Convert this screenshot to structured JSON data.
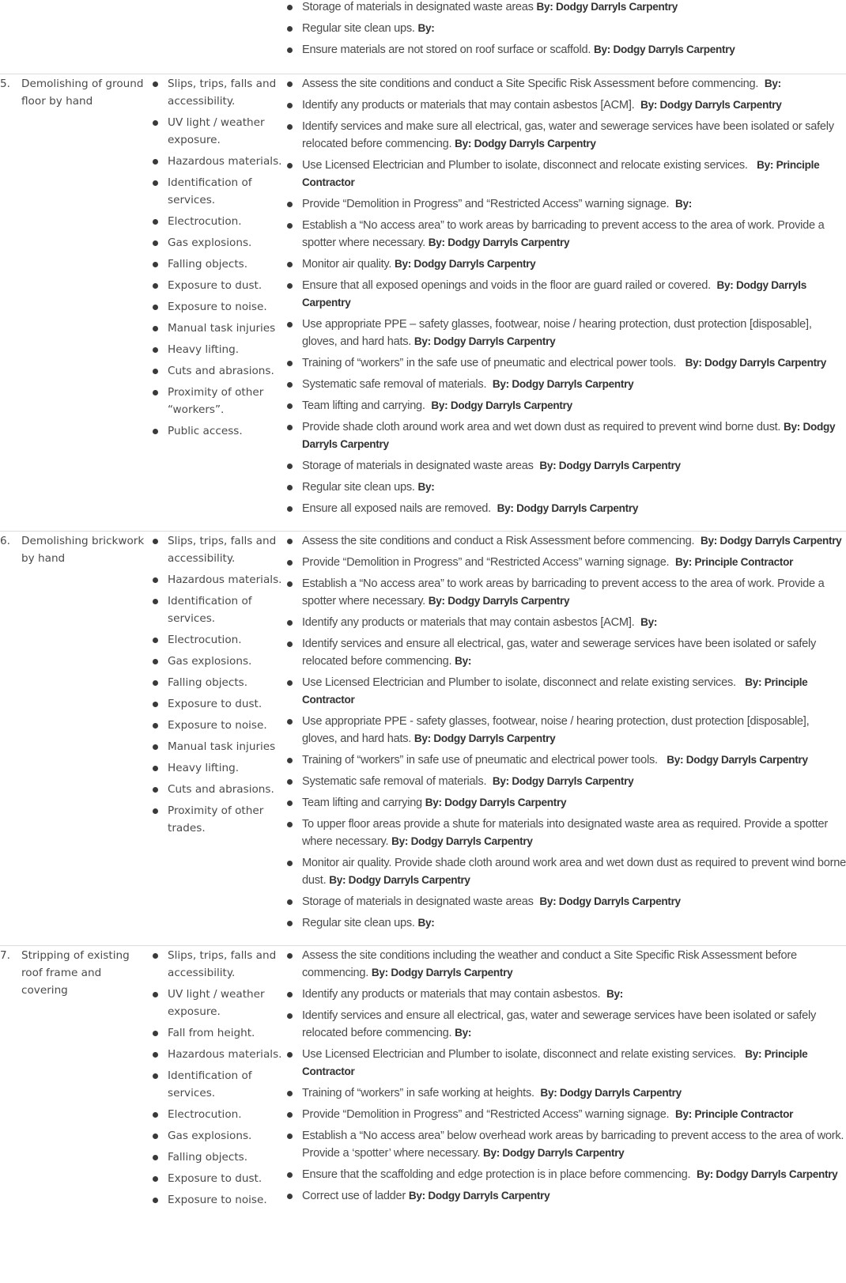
{
  "rows": [
    {
      "number": "",
      "task": "",
      "hazards": [],
      "controls": [
        {
          "text": "Storage of materials in designated waste areas ",
          "by": "By: Dodgy Darryls Carpentry"
        },
        {
          "text": "Regular site clean ups. ",
          "by": "By:"
        },
        {
          "text": "Ensure materials are not stored on roof surface or scaffold. ",
          "by": "By: Dodgy Darryls Carpentry"
        }
      ]
    },
    {
      "number": "5.",
      "task": "Demolishing of ground floor by hand",
      "hazards": [
        "Slips, trips, falls and accessibility.",
        "UV light / weather exposure.",
        "Hazardous materials.",
        "Identification of services.",
        "Electrocution.",
        "Gas explosions.",
        "Falling objects.",
        "Exposure to dust.",
        "Exposure to noise.",
        "Manual task injuries",
        "Heavy lifting.",
        "Cuts and abrasions.",
        "Proximity of other “workers”.",
        "Public access."
      ],
      "controls": [
        {
          "text": "Assess the site conditions and conduct a Site Specific Risk Assessment before commencing.  ",
          "by": "By:"
        },
        {
          "text": "Identify any products or materials that may contain asbestos [ACM].  ",
          "by": "By: Dodgy Darryls Carpentry"
        },
        {
          "text": "Identify services and make sure all electrical, gas, water and sewerage services have been isolated or safely relocated before commencing. ",
          "by": "By: Dodgy Darryls Carpentry"
        },
        {
          "text": "Use Licensed Electrician and Plumber to isolate, disconnect and relocate existing services.   ",
          "by": "By: Principle Contractor"
        },
        {
          "text": "Provide “Demolition in Progress” and “Restricted Access” warning signage.  ",
          "by": "By:"
        },
        {
          "text": "Establish a “No access area” to work areas by barricading to prevent access to the area of work. Provide a spotter where necessary. ",
          "by": "By: Dodgy Darryls Carpentry"
        },
        {
          "text": "Monitor air quality. ",
          "by": "By: Dodgy Darryls Carpentry"
        },
        {
          "text": "Ensure that all exposed openings and voids in the floor are guard railed or covered.  ",
          "by": "By: Dodgy Darryls Carpentry"
        },
        {
          "text": "Use appropriate PPE – safety glasses, footwear, noise / hearing protection, dust protection [disposable], gloves, and hard hats. ",
          "by": "By: Dodgy Darryls Carpentry"
        },
        {
          "text": "Training of “workers” in the safe use of pneumatic and electrical power tools.   ",
          "by": "By: Dodgy Darryls Carpentry"
        },
        {
          "text": "Systematic safe removal of materials.  ",
          "by": "By: Dodgy Darryls Carpentry"
        },
        {
          "text": "Team lifting and carrying.  ",
          "by": "By: Dodgy Darryls Carpentry"
        },
        {
          "text": "Provide shade cloth around work area and wet down dust as required to prevent wind borne dust. ",
          "by": "By: Dodgy Darryls Carpentry"
        },
        {
          "text": "Storage of materials in designated waste areas  ",
          "by": "By: Dodgy Darryls Carpentry"
        },
        {
          "text": "Regular site clean ups. ",
          "by": "By:"
        },
        {
          "text": "Ensure all exposed nails are removed.  ",
          "by": "By: Dodgy Darryls Carpentry"
        }
      ]
    },
    {
      "number": "6.",
      "task": "Demolishing brickwork by hand",
      "hazards": [
        "Slips, trips, falls and accessibility.",
        "Hazardous materials.",
        "Identification of services.",
        "Electrocution.",
        "Gas explosions.",
        "Falling objects.",
        "Exposure to dust.",
        "Exposure to noise.",
        "Manual task injuries",
        "Heavy lifting.",
        "Cuts and abrasions.",
        "Proximity of other trades."
      ],
      "controls": [
        {
          "text": "Assess the site conditions and conduct a Risk Assessment before commencing.  ",
          "by": "By: Dodgy Darryls Carpentry"
        },
        {
          "text": "Provide “Demolition in Progress” and “Restricted Access” warning signage.  ",
          "by": "By: Principle Contractor"
        },
        {
          "text": "Establish a “No access area” to work areas by barricading to prevent access to the area of work. Provide a spotter where necessary. ",
          "by": "By: Dodgy Darryls Carpentry"
        },
        {
          "text": "Identify any products or materials that may contain asbestos [ACM].  ",
          "by": "By:"
        },
        {
          "text": "Identify services and ensure all electrical, gas, water and sewerage services have been isolated or safely relocated before commencing. ",
          "by": "By:"
        },
        {
          "text": "Use Licensed Electrician and Plumber to isolate, disconnect and relate existing services.   ",
          "by": "By: Principle Contractor"
        },
        {
          "text": "Use appropriate PPE - safety glasses, footwear, noise / hearing protection, dust protection [disposable], gloves, and hard hats. ",
          "by": "By: Dodgy Darryls Carpentry"
        },
        {
          "text": "Training of “workers” in safe use of pneumatic and electrical power tools.   ",
          "by": "By: Dodgy Darryls Carpentry"
        },
        {
          "text": "Systematic safe removal of materials.  ",
          "by": "By: Dodgy Darryls Carpentry"
        },
        {
          "text": "Team lifting and carrying ",
          "by": "By: Dodgy Darryls Carpentry"
        },
        {
          "text": "To upper floor areas provide a shute for materials into designated waste area as required. Provide a spotter where necessary. ",
          "by": "By: Dodgy Darryls Carpentry"
        },
        {
          "text": "Monitor air quality. Provide shade cloth around work area and wet down dust as required to prevent wind borne dust. ",
          "by": "By: Dodgy Darryls Carpentry"
        },
        {
          "text": "Storage of materials in designated waste areas  ",
          "by": "By: Dodgy Darryls Carpentry"
        },
        {
          "text": "Regular site clean ups. ",
          "by": "By:"
        }
      ]
    },
    {
      "number": "7.",
      "task": "Stripping of existing roof frame and covering",
      "hazards": [
        "Slips, trips, falls and accessibility.",
        "UV light / weather exposure.",
        "Fall from height.",
        "Hazardous materials.",
        "Identification of services.",
        "Electrocution.",
        "Gas explosions.",
        "Falling objects.",
        "Exposure to dust.",
        "Exposure to noise."
      ],
      "controls": [
        {
          "text": "Assess the site conditions including the weather and conduct a Site Specific Risk Assessment before commencing. ",
          "by": "By: Dodgy Darryls Carpentry"
        },
        {
          "text": "Identify any products or materials that may contain asbestos.  ",
          "by": "By:"
        },
        {
          "text": "Identify services and ensure all electrical, gas, water and sewerage services have been isolated or safely relocated before commencing. ",
          "by": "By:"
        },
        {
          "text": "Use Licensed Electrician and Plumber to isolate, disconnect and relate existing services.   ",
          "by": "By: Principle Contractor"
        },
        {
          "text": "Training of “workers” in safe working at heights.  ",
          "by": "By: Dodgy Darryls Carpentry"
        },
        {
          "text": "Provide “Demolition in Progress” and “Restricted Access” warning signage.  ",
          "by": "By: Principle Contractor"
        },
        {
          "text": "Establish a “No access area” below overhead work areas by barricading to prevent access to the area of work. Provide a ‘spotter’ where necessary. ",
          "by": "By: Dodgy Darryls Carpentry"
        },
        {
          "text": "Ensure that the scaffolding and edge protection is in place before commencing.  ",
          "by": "By: Dodgy Darryls Carpentry"
        },
        {
          "text": "Correct use of ladder ",
          "by": "By: Dodgy Darryls Carpentry"
        }
      ]
    }
  ]
}
